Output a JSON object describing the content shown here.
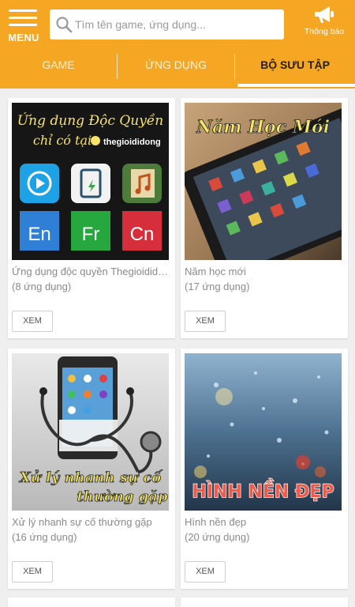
{
  "header": {
    "menu_label": "MENU",
    "search_placeholder": "Tìm tên game, ứng dụng...",
    "notification_label": "Thông báo"
  },
  "tabs": [
    {
      "label": "GAME",
      "active": false
    },
    {
      "label": "ỨNG DỤNG",
      "active": false
    },
    {
      "label": "BỘ SƯU TẬP",
      "active": true
    }
  ],
  "collections": [
    {
      "title": "Ứng dụng độc quyền Thegioididong",
      "count": "(8 ứng dụng)",
      "button": "XEM",
      "banner_line1": "Ứng dụng Độc Quyền",
      "banner_line2": "chỉ có tại",
      "brand": "thegioididong",
      "app_letters": [
        "En",
        "Fr",
        "Cn"
      ]
    },
    {
      "title": "Năm học mới",
      "count": "(17 ứng dụng)",
      "button": "XEM",
      "banner_text": "Năm Học Mới"
    },
    {
      "title": "Xử lý nhanh sự cố thường gặp",
      "count": "(16 ứng dụng)",
      "button": "XEM",
      "banner_line1": "Xử lý nhanh sự cố",
      "banner_line2": "thường gặp"
    },
    {
      "title": "Hình nền đẹp",
      "count": "(20 ứng dụng)",
      "button": "XEM",
      "banner_text": "HÌNH NỀN ĐẸP"
    }
  ],
  "colors": {
    "header": "#f5a623",
    "active_tab_text": "#2b1e00"
  }
}
